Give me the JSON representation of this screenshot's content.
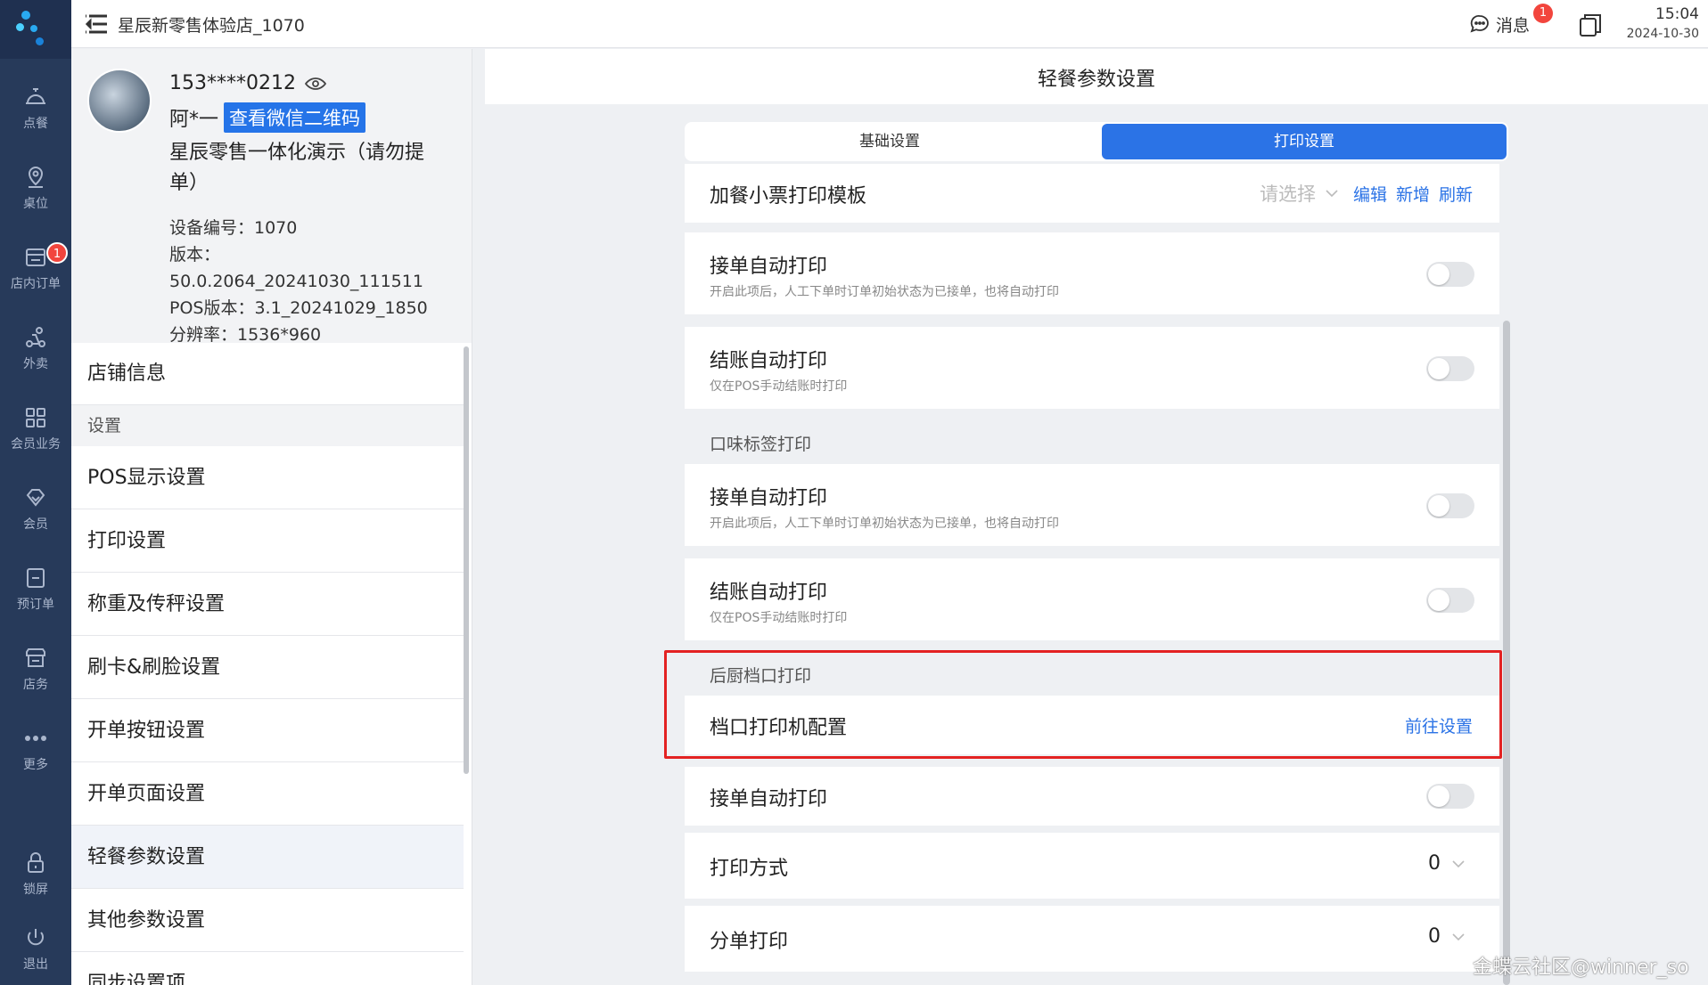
{
  "nav": {
    "items": [
      {
        "label": "点餐",
        "icon": "bell-cloche-icon"
      },
      {
        "label": "桌位",
        "icon": "location-pin-icon"
      },
      {
        "label": "店内订单",
        "icon": "order-list-icon",
        "badge": "1"
      },
      {
        "label": "外卖",
        "icon": "scooter-icon"
      },
      {
        "label": "会员业务",
        "icon": "grid-icon"
      },
      {
        "label": "会员",
        "icon": "diamond-icon"
      },
      {
        "label": "预订单",
        "icon": "calendar-icon"
      },
      {
        "label": "店务",
        "icon": "shop-icon"
      },
      {
        "label": "更多",
        "icon": "more-dots-icon"
      },
      {
        "label": "锁屏",
        "icon": "lock-icon"
      },
      {
        "label": "退出",
        "icon": "power-icon"
      }
    ]
  },
  "header": {
    "store_name": "星辰新零售体验店_1070",
    "message_label": "消息",
    "message_badge": "1",
    "time": "15:04",
    "date": "2024-10-30"
  },
  "profile": {
    "phone": "153****0212",
    "name": "阿*一",
    "qr_button": "查看微信二维码",
    "company": "星辰零售一体化演示（请勿提单）",
    "device_no": "设备编号：1070",
    "version": "版本：50.0.2064_20241030_111511",
    "pos_version": "POS版本：3.1_20241029_1850",
    "resolution": "分辨率：1536*960"
  },
  "menu": {
    "store_info": "店铺信息",
    "section_settings": "设置",
    "items": [
      "POS显示设置",
      "打印设置",
      "称重及传秤设置",
      "刷卡&刷脸设置",
      "开单按钮设置",
      "开单页面设置",
      "轻餐参数设置",
      "其他参数设置",
      "同步设置项"
    ]
  },
  "content": {
    "title": "轻餐参数设置",
    "tab_basic": "基础设置",
    "tab_print": "打印设置",
    "add_receipt_template": {
      "label": "加餐小票打印模板",
      "placeholder": "请选择",
      "edit": "编辑",
      "add": "新增",
      "refresh": "刷新"
    },
    "auto_print_on_accept": {
      "label": "接单自动打印",
      "desc": "开启此项后，人工下单时订单初始状态为已接单，也将自动打印"
    },
    "auto_print_on_checkout": {
      "label": "结账自动打印",
      "desc": "仅在POS手动结账时打印"
    },
    "flavor_label_section": "口味标签打印",
    "flavor_auto_print_on_accept": {
      "label": "接单自动打印",
      "desc": "开启此项后，人工下单时订单初始状态为已接单，也将自动打印"
    },
    "flavor_auto_print_on_checkout": {
      "label": "结账自动打印",
      "desc": "仅在POS手动结账时打印"
    },
    "kitchen_section": "后厨档口打印",
    "kitchen_printer_config": {
      "label": "档口打印机配置",
      "link": "前往设置"
    },
    "kitchen_auto_print_on_accept": {
      "label": "接单自动打印"
    },
    "print_mode": {
      "label": "打印方式",
      "value": "0"
    },
    "split_print": {
      "label": "分单打印",
      "value": "0"
    }
  },
  "watermark": "金蝶云社区@winner_so"
}
